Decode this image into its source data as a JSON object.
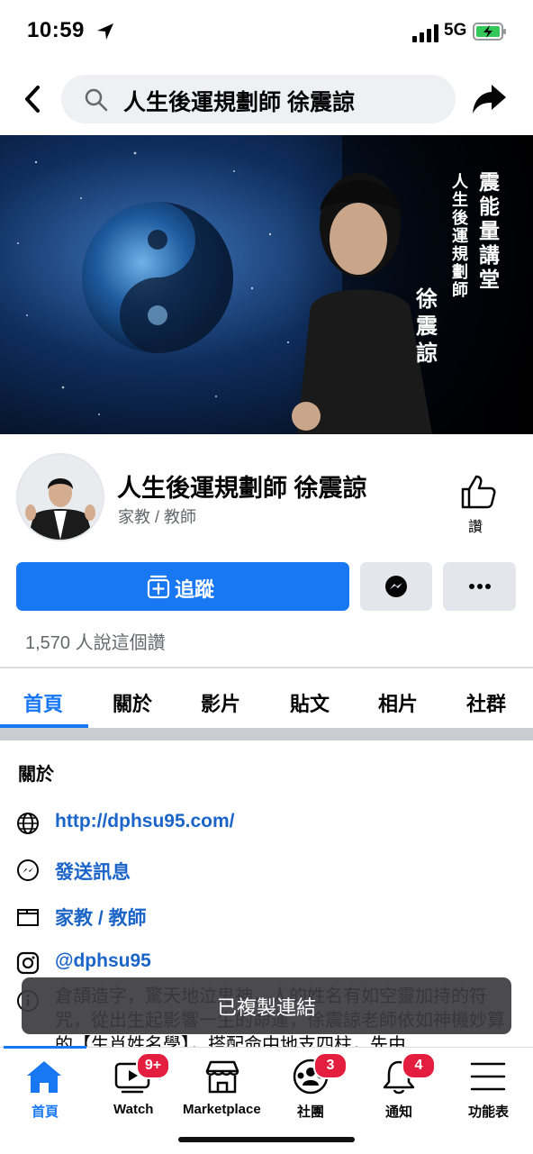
{
  "status_bar": {
    "time": "10:59",
    "network": "5G"
  },
  "search": {
    "query": "人生後運規劃師 徐震諒"
  },
  "cover": {
    "title": "震能量講堂",
    "subtitle": "人生後運規劃師",
    "name": "徐震諒"
  },
  "profile": {
    "name": "人生後運規劃師 徐震諒",
    "category": "家教 / 教師",
    "like_label": "讚",
    "follow_label": "追蹤",
    "likes_count": "1,570 人說這個讚"
  },
  "tabs": [
    {
      "label": "首頁"
    },
    {
      "label": "關於"
    },
    {
      "label": "影片"
    },
    {
      "label": "貼文"
    },
    {
      "label": "相片"
    },
    {
      "label": "社群"
    }
  ],
  "about": {
    "title": "關於",
    "website": "http://dphsu95.com/",
    "message": "發送訊息",
    "category": "家教 / 教師",
    "instagram": "@dphsu95",
    "description": "倉頡造字，驚天地泣鬼神，人的姓名有如空靈加持的符咒，從出生起影響一生的命運，徐震諒老師依如神機妙算的【生肖姓名學】，搭配命中地支四柱，先由"
  },
  "toast": "已複製連結",
  "bottom_nav": [
    {
      "label": "首頁",
      "icon": "home-icon"
    },
    {
      "label": "Watch",
      "icon": "watch-icon",
      "badge": "9+"
    },
    {
      "label": "Marketplace",
      "icon": "marketplace-icon"
    },
    {
      "label": "社團",
      "icon": "groups-icon",
      "badge": "3"
    },
    {
      "label": "通知",
      "icon": "bell-icon",
      "badge": "4"
    },
    {
      "label": "功能表",
      "icon": "menu-icon"
    }
  ],
  "colors": {
    "accent": "#1877f2",
    "badge": "#e41e3f",
    "link": "#1b64c8"
  }
}
